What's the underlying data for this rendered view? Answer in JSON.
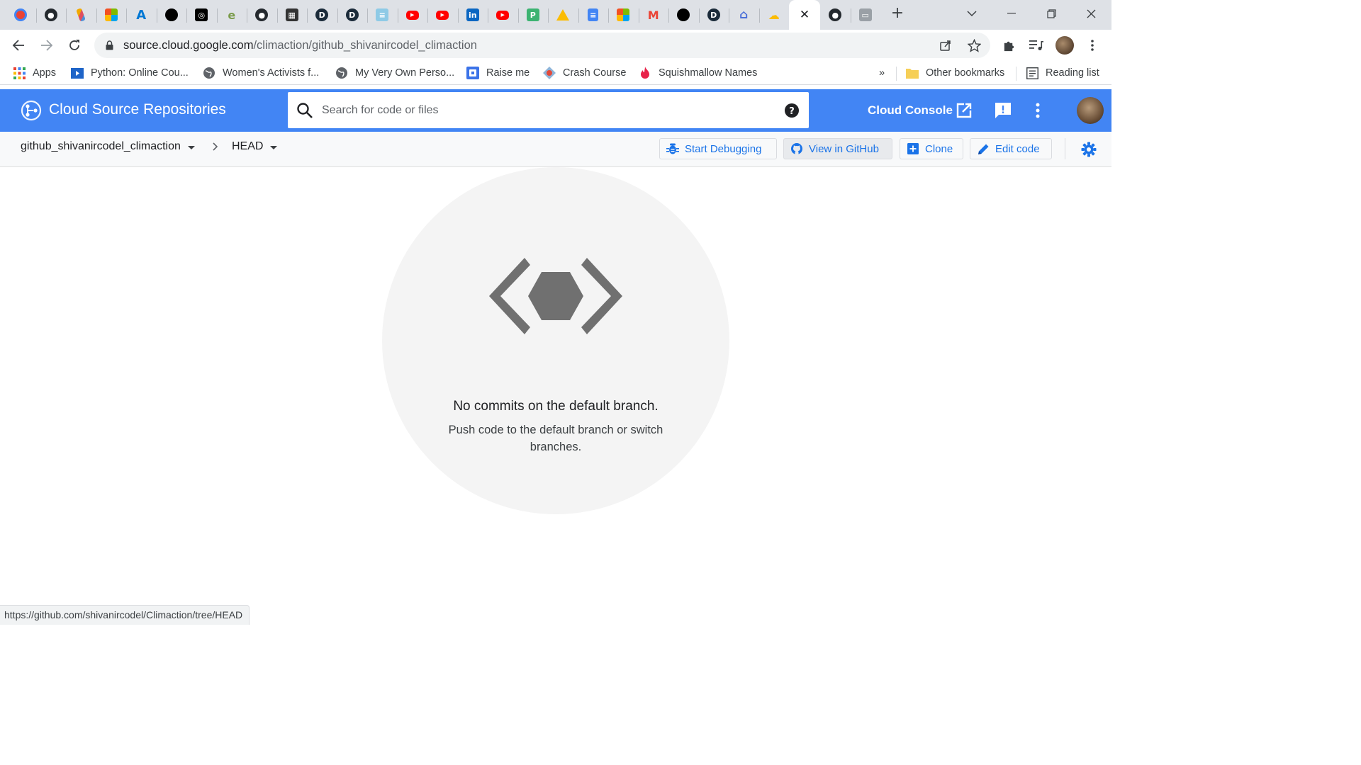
{
  "browser": {
    "tabs": [
      {
        "icon": "google-one-icon"
      },
      {
        "icon": "github-icon"
      },
      {
        "icon": "paintbrush-icon"
      },
      {
        "icon": "microsoft-icon"
      },
      {
        "icon": "azure-icon"
      },
      {
        "icon": "black-circle-icon"
      },
      {
        "icon": "openai-icon"
      },
      {
        "icon": "edge-icon"
      },
      {
        "icon": "github-icon"
      },
      {
        "icon": "clapperboard-icon"
      },
      {
        "icon": "d-logo-icon"
      },
      {
        "icon": "d-logo-icon"
      },
      {
        "icon": "stack-icon"
      },
      {
        "icon": "youtube-icon"
      },
      {
        "icon": "youtube-icon"
      },
      {
        "icon": "linkedin-icon"
      },
      {
        "icon": "youtube-icon"
      },
      {
        "icon": "p-logo-icon"
      },
      {
        "icon": "google-drive-icon"
      },
      {
        "icon": "google-docs-icon"
      },
      {
        "icon": "microsoft-icon"
      },
      {
        "icon": "gmail-icon"
      },
      {
        "icon": "black-circle-icon"
      },
      {
        "icon": "d-logo-icon"
      },
      {
        "icon": "home-icon"
      },
      {
        "icon": "google-cloud-icon"
      },
      {
        "icon": "close-icon",
        "active": true
      },
      {
        "icon": "github-icon"
      },
      {
        "icon": "monitor-icon"
      }
    ],
    "url_host": "source.cloud.google.com",
    "url_path": "/climaction/github_shivanircodel_climaction",
    "bookmarks": [
      {
        "label": "Apps",
        "icon": "apps-grid-icon"
      },
      {
        "label": "Python: Online Cou...",
        "icon": "play-video-icon"
      },
      {
        "label": "Women's Activists f...",
        "icon": "globe-icon"
      },
      {
        "label": "My Very Own Perso...",
        "icon": "globe-icon"
      },
      {
        "label": "Raise me",
        "icon": "raise-me-icon"
      },
      {
        "label": "Crash Course",
        "icon": "crash-course-icon"
      },
      {
        "label": "Squishmallow Names",
        "icon": "flame-icon"
      }
    ],
    "bookmarks_overflow": "»",
    "other_bookmarks": "Other bookmarks",
    "reading_list": "Reading list",
    "status_url": "https://github.com/shivanircodel/Climaction/tree/HEAD"
  },
  "app": {
    "title": "Cloud Source Repositories",
    "search_placeholder": "Search for code or files",
    "cloud_console": "Cloud Console",
    "colors": {
      "header": "#4285f4",
      "action": "#1a73e8"
    }
  },
  "repo": {
    "name": "github_shivanircodel_climaction",
    "branch": "HEAD"
  },
  "actions": {
    "start_debugging": "Start Debugging",
    "view_in_github": "View in GitHub",
    "clone": "Clone",
    "edit_code": "Edit code"
  },
  "empty_state": {
    "title": "No commits on the default branch.",
    "message": "Push code to the default branch or switch branches."
  }
}
